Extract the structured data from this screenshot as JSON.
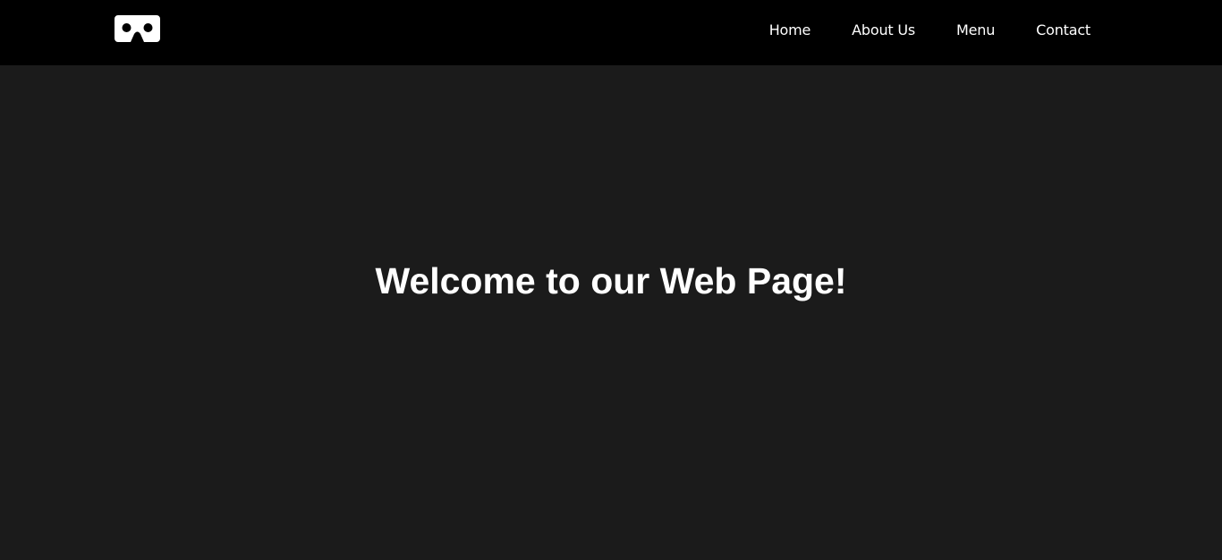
{
  "header": {
    "logo_icon": "vr-headset-icon",
    "nav": [
      {
        "label": "Home"
      },
      {
        "label": "About Us"
      },
      {
        "label": "Menu"
      },
      {
        "label": "Contact"
      }
    ]
  },
  "main": {
    "title": "Welcome to our Web Page!"
  },
  "colors": {
    "header_bg": "#000000",
    "page_bg": "#1b1b1b",
    "text": "#ffffff"
  }
}
